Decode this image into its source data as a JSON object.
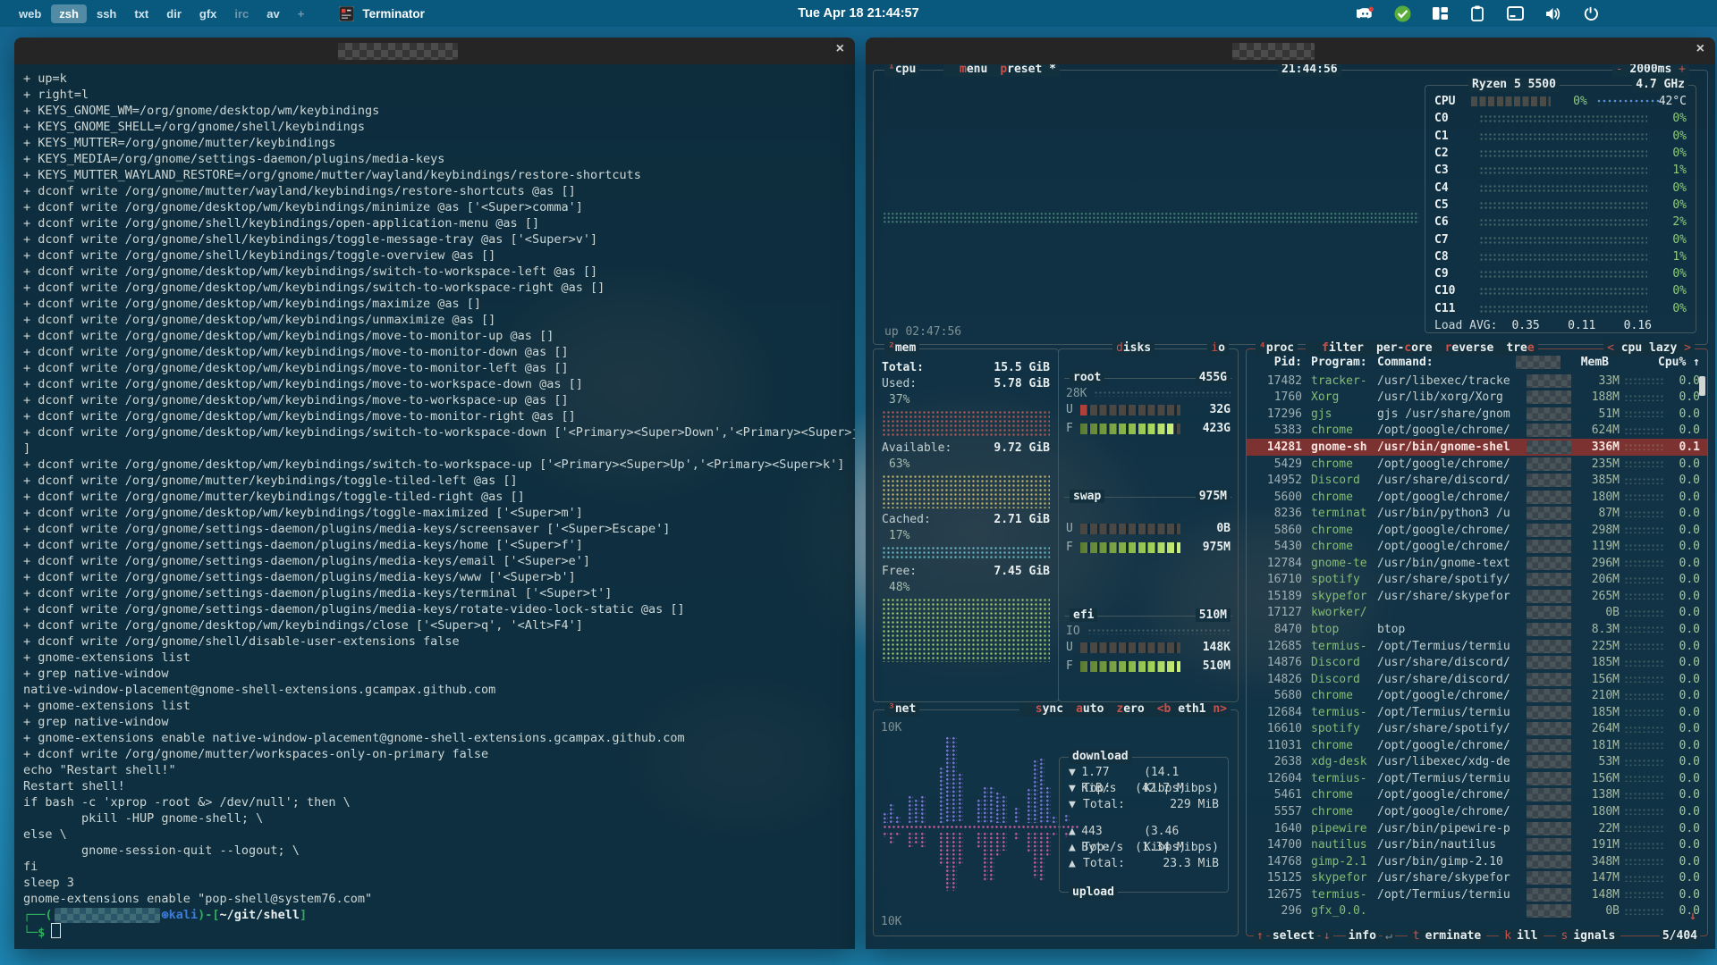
{
  "topbar": {
    "workspaces": [
      {
        "label": "web",
        "active": false,
        "dim": false
      },
      {
        "label": "zsh",
        "active": true,
        "dim": false
      },
      {
        "label": "ssh",
        "active": false,
        "dim": false
      },
      {
        "label": "txt",
        "active": false,
        "dim": false
      },
      {
        "label": "dir",
        "active": false,
        "dim": false
      },
      {
        "label": "gfx",
        "active": false,
        "dim": false
      },
      {
        "label": "irc",
        "active": false,
        "dim": true
      },
      {
        "label": "av",
        "active": false,
        "dim": false
      },
      {
        "label": "+",
        "active": false,
        "dim": true
      }
    ],
    "app_title": "Terminator",
    "clock": "Tue Apr 18  21:44:57",
    "tray": [
      "discord",
      "check",
      "tiling",
      "clipboard",
      "terminal",
      "volume",
      "power"
    ]
  },
  "left_terminal": {
    "close": "×",
    "lines": [
      "+ up=k",
      "+ right=l",
      "+ KEYS_GNOME_WM=/org/gnome/desktop/wm/keybindings",
      "+ KEYS_GNOME_SHELL=/org/gnome/shell/keybindings",
      "+ KEYS_MUTTER=/org/gnome/mutter/keybindings",
      "+ KEYS_MEDIA=/org/gnome/settings-daemon/plugins/media-keys",
      "+ KEYS_MUTTER_WAYLAND_RESTORE=/org/gnome/mutter/wayland/keybindings/restore-shortcuts",
      "+ dconf write /org/gnome/mutter/wayland/keybindings/restore-shortcuts @as []",
      "+ dconf write /org/gnome/desktop/wm/keybindings/minimize @as ['<Super>comma']",
      "+ dconf write /org/gnome/shell/keybindings/open-application-menu @as []",
      "+ dconf write /org/gnome/shell/keybindings/toggle-message-tray @as ['<Super>v']",
      "+ dconf write /org/gnome/shell/keybindings/toggle-overview @as []",
      "+ dconf write /org/gnome/desktop/wm/keybindings/switch-to-workspace-left @as []",
      "+ dconf write /org/gnome/desktop/wm/keybindings/switch-to-workspace-right @as []",
      "+ dconf write /org/gnome/desktop/wm/keybindings/maximize @as []",
      "+ dconf write /org/gnome/desktop/wm/keybindings/unmaximize @as []",
      "+ dconf write /org/gnome/desktop/wm/keybindings/move-to-monitor-up @as []",
      "+ dconf write /org/gnome/desktop/wm/keybindings/move-to-monitor-down @as []",
      "+ dconf write /org/gnome/desktop/wm/keybindings/move-to-monitor-left @as []",
      "+ dconf write /org/gnome/desktop/wm/keybindings/move-to-workspace-down @as []",
      "+ dconf write /org/gnome/desktop/wm/keybindings/move-to-workspace-up @as []",
      "+ dconf write /org/gnome/desktop/wm/keybindings/move-to-monitor-right @as []",
      "+ dconf write /org/gnome/desktop/wm/keybindings/switch-to-workspace-down ['<Primary><Super>Down','<Primary><Super>j'",
      "]",
      "+ dconf write /org/gnome/desktop/wm/keybindings/switch-to-workspace-up ['<Primary><Super>Up','<Primary><Super>k']",
      "+ dconf write /org/gnome/mutter/keybindings/toggle-tiled-left @as []",
      "+ dconf write /org/gnome/mutter/keybindings/toggle-tiled-right @as []",
      "+ dconf write /org/gnome/desktop/wm/keybindings/toggle-maximized ['<Super>m']",
      "+ dconf write /org/gnome/settings-daemon/plugins/media-keys/screensaver ['<Super>Escape']",
      "+ dconf write /org/gnome/settings-daemon/plugins/media-keys/home ['<Super>f']",
      "+ dconf write /org/gnome/settings-daemon/plugins/media-keys/email ['<Super>e']",
      "+ dconf write /org/gnome/settings-daemon/plugins/media-keys/www ['<Super>b']",
      "+ dconf write /org/gnome/settings-daemon/plugins/media-keys/terminal ['<Super>t']",
      "+ dconf write /org/gnome/settings-daemon/plugins/media-keys/rotate-video-lock-static @as []",
      "+ dconf write /org/gnome/desktop/wm/keybindings/close ['<Super>q', '<Alt>F4']",
      "+ dconf write /org/gnome/shell/disable-user-extensions false",
      "+ gnome-extensions list",
      "+ grep native-window",
      "native-window-placement@gnome-shell-extensions.gcampax.github.com",
      "+ gnome-extensions list",
      "+ grep native-window",
      "+ gnome-extensions enable native-window-placement@gnome-shell-extensions.gcampax.github.com",
      "+ dconf write /org/gnome/mutter/workspaces-only-on-primary false",
      "echo \"Restart shell!\"",
      "Restart shell!",
      "if bash -c 'xprop -root &> /dev/null'; then \\",
      "        pkill -HUP gnome-shell; \\",
      "else \\",
      "        gnome-session-quit --logout; \\",
      "fi",
      "sleep 3",
      "gnome-extensions enable \"pop-shell@system76.com\""
    ],
    "prompt": [
      [
        {
          "t": "┌──(",
          "c": "g"
        },
        {
          "c": "blur",
          "w": 118
        },
        {
          "t": "⊛kali",
          "c": "b"
        },
        {
          "t": ")-[",
          "c": "g"
        },
        {
          "t": "~/git/shell",
          "c": "w"
        },
        {
          "t": "]",
          "c": "g"
        }
      ],
      [
        {
          "t": "└─$",
          "c": "g"
        },
        {
          "c": "cursor"
        }
      ]
    ]
  },
  "btop": {
    "close": "×",
    "cpu": {
      "sup": "¹",
      "title": "cpu",
      "buttons": [
        {
          "label": "menu",
          "hot": 0
        },
        {
          "label": "preset *",
          "hot": 0
        }
      ],
      "time": "21:44:56",
      "interval_minus": "-",
      "interval": "2000ms",
      "interval_plus": "+",
      "model": "Ryzen 5 5500",
      "freq": "4.7 GHz",
      "cpu_row": {
        "label": "CPU",
        "pct": "0%",
        "temp": "42°C"
      },
      "cores": [
        {
          "label": "C0",
          "pct": "0%"
        },
        {
          "label": "C1",
          "pct": "0%"
        },
        {
          "label": "C2",
          "pct": "0%"
        },
        {
          "label": "C3",
          "pct": "1%"
        },
        {
          "label": "C4",
          "pct": "0%"
        },
        {
          "label": "C5",
          "pct": "0%"
        },
        {
          "label": "C6",
          "pct": "2%"
        },
        {
          "label": "C7",
          "pct": "0%"
        },
        {
          "label": "C8",
          "pct": "1%"
        },
        {
          "label": "C9",
          "pct": "0%"
        },
        {
          "label": "C10",
          "pct": "0%"
        },
        {
          "label": "C11",
          "pct": "0%"
        }
      ],
      "load_label": "Load AVG:",
      "load_values": "0.35    0.11    0.16",
      "uptime": "up 02:47:56"
    },
    "mem": {
      "sup": "²",
      "title": "mem",
      "entries": [
        {
          "label": "Total:",
          "value": "15.5 GiB",
          "pct": null,
          "color": null
        },
        {
          "label": "Used:",
          "value": "5.78 GiB",
          "pct": "37%",
          "color": "#c05d58"
        },
        {
          "label": "Available:",
          "value": "9.72 GiB",
          "pct": "63%",
          "color": "#cdbd6c"
        },
        {
          "label": "Cached:",
          "value": "2.71 GiB",
          "pct": "17%",
          "color": "#6cc0ce"
        },
        {
          "label": "Free:",
          "value": "7.45 GiB",
          "pct": "48%",
          "color": "#a4d66e"
        }
      ]
    },
    "disks": {
      "hot": "d",
      "rest": "isks",
      "io_hot": "i",
      "io_rest": "o",
      "items": [
        {
          "name": "root",
          "size": "455G",
          "extra": "28K",
          "u_val": "32G",
          "f_val": "423G",
          "u_red": true,
          "f_frac": 0.93
        },
        {
          "name": "swap",
          "size": "975M",
          "extra": null,
          "u_val": "0B",
          "f_val": "975M",
          "u_red": false,
          "f_frac": 1.0
        },
        {
          "name": "efi",
          "size": "510M",
          "extra": "IO",
          "u_val": "148K",
          "f_val": "510M",
          "u_red": false,
          "f_frac": 1.0
        }
      ]
    },
    "net": {
      "sup": "³",
      "title": "net",
      "buttons": [
        {
          "label": "sync",
          "hot": 0
        },
        {
          "label": "auto",
          "hot": 0
        },
        {
          "label": "zero",
          "hot": 0
        }
      ],
      "eth_segments": [
        {
          "t": "<b",
          "c": "red"
        },
        {
          "t": " eth1 ",
          "c": "wb"
        },
        {
          "t": "n>",
          "c": "red"
        }
      ],
      "scale_top": "10K",
      "scale_bottom": "10K",
      "download_label": "download",
      "upload_label": "upload",
      "down_stats": [
        [
          "▼",
          "1.77 KiB/s",
          "(14.1 Kibps)"
        ],
        [
          "▼",
          "Top:",
          "(42.7 Mibps)"
        ],
        [
          "▼",
          "Total:",
          "229 MiB"
        ]
      ],
      "up_stats": [
        [
          "▲",
          "443 Byte/s",
          "(3.46 Kibps)"
        ],
        [
          "▲",
          "Top:",
          "(1.34 Mibps)"
        ],
        [
          "▲",
          "Total:",
          "23.3 MiB"
        ]
      ],
      "down_graph": [
        12,
        22,
        8,
        0,
        30,
        26,
        30,
        0,
        0,
        62,
        95,
        95,
        55,
        0,
        0,
        26,
        40,
        40,
        34,
        30,
        0,
        18,
        0,
        38,
        70,
        72,
        40,
        8,
        0,
        10
      ],
      "up_graph": [
        6,
        14,
        4,
        0,
        18,
        14,
        18,
        0,
        0,
        40,
        70,
        70,
        40,
        0,
        0,
        20,
        60,
        60,
        30,
        22,
        0,
        10,
        0,
        26,
        55,
        58,
        30,
        4,
        0,
        6
      ]
    },
    "proc": {
      "sup": "⁴",
      "title": "proc",
      "options": [
        {
          "label": "filter",
          "hot": 0
        },
        {
          "label": "per-core",
          "hot": 4
        },
        {
          "label": "reverse",
          "hot": 0
        },
        {
          "label": "tree",
          "hot": 3
        }
      ],
      "sort_left": "<",
      "sort_label": " cpu lazy ",
      "sort_right": ">",
      "col_pid": "Pid:",
      "col_program": "Program:",
      "col_command": "Command:",
      "col_mem": "MemB",
      "col_cpu": "Cpu% ↑",
      "selected_pid": "14281",
      "rows": [
        [
          "17482",
          "tracker-",
          "/usr/libexec/tracke",
          "33M",
          "0.0"
        ],
        [
          "1760",
          "Xorg",
          "/usr/lib/xorg/Xorg",
          "188M",
          "0.0"
        ],
        [
          "17296",
          "gjs",
          "gjs /usr/share/gnom",
          "51M",
          "0.0"
        ],
        [
          "5383",
          "chrome",
          "/opt/google/chrome/",
          "624M",
          "0.0"
        ],
        [
          "14281",
          "gnome-sh",
          "/usr/bin/gnome-shel",
          "336M",
          "0.1"
        ],
        [
          "5429",
          "chrome",
          "/opt/google/chrome/",
          "235M",
          "0.0"
        ],
        [
          "14952",
          "Discord",
          "/usr/share/discord/",
          "385M",
          "0.0"
        ],
        [
          "5600",
          "chrome",
          "/opt/google/chrome/",
          "180M",
          "0.0"
        ],
        [
          "8236",
          "terminat",
          "/usr/bin/python3 /u",
          "87M",
          "0.0"
        ],
        [
          "5860",
          "chrome",
          "/opt/google/chrome/",
          "298M",
          "0.0"
        ],
        [
          "5430",
          "chrome",
          "/opt/google/chrome/",
          "119M",
          "0.0"
        ],
        [
          "12784",
          "gnome-te",
          "/usr/bin/gnome-text",
          "296M",
          "0.0"
        ],
        [
          "16710",
          "spotify",
          "/usr/share/spotify/",
          "206M",
          "0.0"
        ],
        [
          "15189",
          "skypefor",
          "/usr/share/skypefor",
          "265M",
          "0.0"
        ],
        [
          "17127",
          "kworker/",
          "",
          "0B",
          "0.0"
        ],
        [
          "8470",
          "btop",
          "btop",
          "8.3M",
          "0.0"
        ],
        [
          "12685",
          "termius-",
          "/opt/Termius/termiu",
          "225M",
          "0.0"
        ],
        [
          "14876",
          "Discord",
          "/usr/share/discord/",
          "185M",
          "0.0"
        ],
        [
          "14826",
          "Discord",
          "/usr/share/discord/",
          "156M",
          "0.0"
        ],
        [
          "5680",
          "chrome",
          "/opt/google/chrome/",
          "210M",
          "0.0"
        ],
        [
          "12684",
          "termius-",
          "/opt/Termius/termiu",
          "185M",
          "0.0"
        ],
        [
          "16610",
          "spotify",
          "/usr/share/spotify/",
          "264M",
          "0.0"
        ],
        [
          "11031",
          "chrome",
          "/opt/google/chrome/",
          "181M",
          "0.0"
        ],
        [
          "2638",
          "xdg-desk",
          "/usr/libexec/xdg-de",
          "53M",
          "0.0"
        ],
        [
          "12604",
          "termius-",
          "/opt/Termius/termiu",
          "156M",
          "0.0"
        ],
        [
          "5461",
          "chrome",
          "/opt/google/chrome/",
          "138M",
          "0.0"
        ],
        [
          "5557",
          "chrome",
          "/opt/google/chrome/",
          "180M",
          "0.0"
        ],
        [
          "1640",
          "pipewire",
          "/usr/bin/pipewire-p",
          "22M",
          "0.0"
        ],
        [
          "14700",
          "nautilus",
          "/usr/bin/nautilus",
          "191M",
          "0.0"
        ],
        [
          "14768",
          "gimp-2.1",
          "/usr/bin/gimp-2.10",
          "348M",
          "0.0"
        ],
        [
          "15125",
          "skypefor",
          "/usr/share/skypefor",
          "147M",
          "0.0"
        ],
        [
          "12675",
          "termius-",
          "/opt/Termius/termiu",
          "148M",
          "0.0"
        ],
        [
          "296",
          "gfx_0.0.",
          "",
          "0B",
          "0.0"
        ]
      ],
      "scroll_indicator": "↓",
      "footer": {
        "up": "↑",
        "select": "select",
        "down": "↓",
        "info": "info",
        "enter": "↵",
        "terminate": {
          "hot": "t",
          "rest": "erminate"
        },
        "kill": {
          "hot": "k",
          "rest": "ill"
        },
        "signals": {
          "hot": "s",
          "rest": "ignals"
        },
        "count": "5/404"
      }
    }
  }
}
